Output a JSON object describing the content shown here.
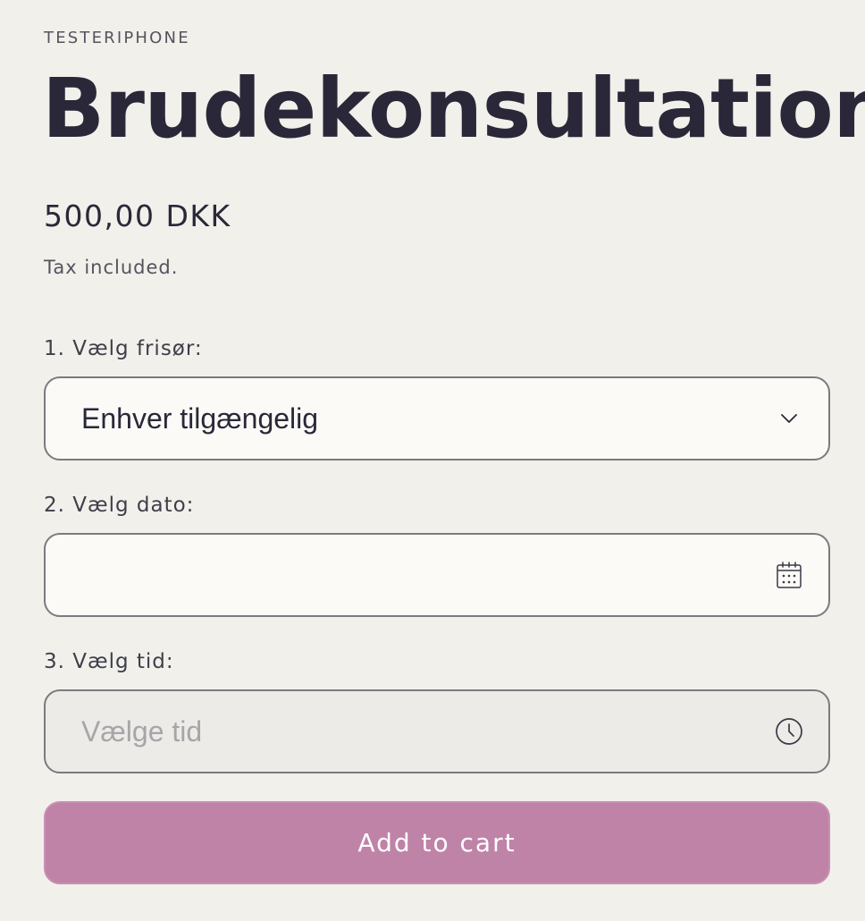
{
  "product": {
    "vendor": "TESTERIPHONE",
    "title": "Brudekonsultation",
    "price": "500,00 DKK",
    "tax_note": "Tax included."
  },
  "form": {
    "stylist": {
      "label": "1. Vælg frisør:",
      "value": "Enhver tilgængelig",
      "icon": "chevron-down-icon"
    },
    "date": {
      "label": "2. Vælg dato:",
      "value": "",
      "icon": "calendar-icon"
    },
    "time": {
      "label": "3. Vælg tid:",
      "placeholder": "Vælge tid",
      "icon": "clock-icon"
    }
  },
  "actions": {
    "add_to_cart_label": "Add to cart"
  },
  "colors": {
    "background": "#f1f0eb",
    "text": "#2a2838",
    "accent_button": "#bf83a8"
  }
}
